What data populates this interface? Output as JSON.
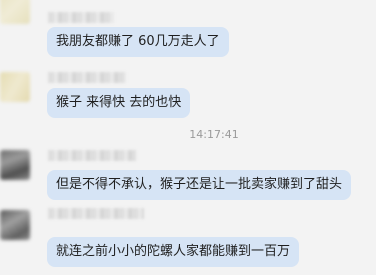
{
  "messages": [
    {
      "text": "我朋友都赚了 60几万走人了"
    },
    {
      "text": "猴子 来得快 去的也快"
    },
    {
      "text": "但是不得不承认，猴子还是让一批卖家赚到了甜头"
    },
    {
      "text": "就连之前小小的陀螺人家都能赚到一百万"
    }
  ],
  "timestamp": "14:17:41"
}
